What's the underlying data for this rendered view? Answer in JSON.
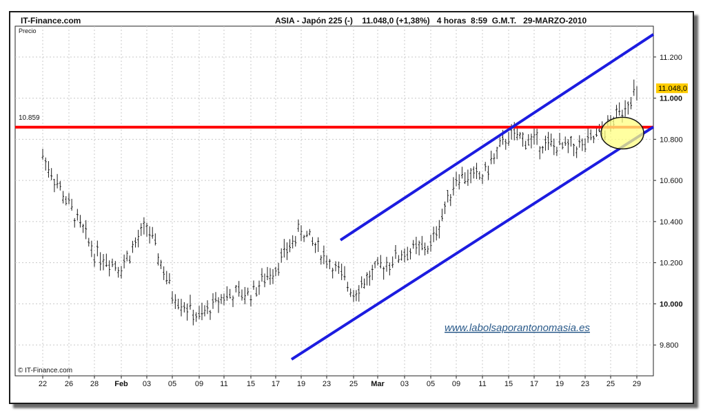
{
  "header": {
    "brand": "IT-Finance.com",
    "instrument": "ASIA - Japón 225 (-)",
    "last_value": "11.048,0 (+1,38%)",
    "period": "4 horas",
    "time": "8:59",
    "timezone": "G.M.T.",
    "date": "29-MARZO-2010"
  },
  "footer": {
    "copyright": "© IT-Finance.com"
  },
  "watermark": "www.labolsaporantonomasia.es",
  "colors": {
    "candle": "#1a1a1a",
    "resistance": "#ff0000",
    "channel": "#1c1ce0",
    "highlight_fill": "#ffff80",
    "last_label_bg": "#ffcc00",
    "watermark": "#2a5a8a"
  },
  "chart_data": {
    "type": "line",
    "ylabel": "Precio",
    "ylim": [
      9650,
      11350
    ],
    "y_ticks": [
      9800,
      10000,
      10200,
      10400,
      10600,
      10800,
      11000,
      11200
    ],
    "y_tick_labels": [
      "9.800",
      "10.000",
      "10.200",
      "10.400",
      "10.600",
      "10.800",
      "11.000",
      "11.200"
    ],
    "y_tick_bold": [
      false,
      true,
      false,
      false,
      false,
      false,
      true,
      false
    ],
    "x_ticks": [
      "22",
      "26",
      "28",
      "Feb",
      "03",
      "05",
      "09",
      "11",
      "15",
      "17",
      "19",
      "23",
      "25",
      "Mar",
      "03",
      "05",
      "09",
      "11",
      "15",
      "17",
      "19",
      "23",
      "25",
      "29"
    ],
    "x_tick_bold": [
      false,
      false,
      false,
      true,
      false,
      false,
      false,
      false,
      false,
      false,
      false,
      false,
      false,
      true,
      false,
      false,
      false,
      false,
      false,
      false,
      false,
      false,
      false,
      false
    ],
    "series": [
      {
        "x": [
          "22",
          "26",
          "28",
          "Feb",
          "03",
          "05",
          "09",
          "11",
          "15",
          "17",
          "19",
          "23",
          "25",
          "Mar",
          "03",
          "05",
          "09",
          "11",
          "15",
          "17",
          "19",
          "23",
          "25",
          "29"
        ],
        "values": [
          10720,
          10480,
          10250,
          10180,
          10380,
          10050,
          9930,
          10040,
          10050,
          10180,
          10360,
          10220,
          10060,
          10170,
          10250,
          10280,
          10620,
          10620,
          10820,
          10790,
          10760,
          10770,
          10870,
          11048
        ]
      }
    ],
    "resistance": {
      "value": 10859,
      "label": "10.859"
    },
    "last_price": {
      "value": 11048,
      "label": "11.048,0"
    },
    "channel_upper": [
      {
        "x": "24",
        "y": 10310
      },
      {
        "x": "30",
        "y": 11310
      }
    ],
    "channel_lower": [
      {
        "x": "18",
        "y": 9730
      },
      {
        "x": "30",
        "y": 10860
      }
    ],
    "highlight": {
      "x": "27",
      "y": 10830
    }
  }
}
